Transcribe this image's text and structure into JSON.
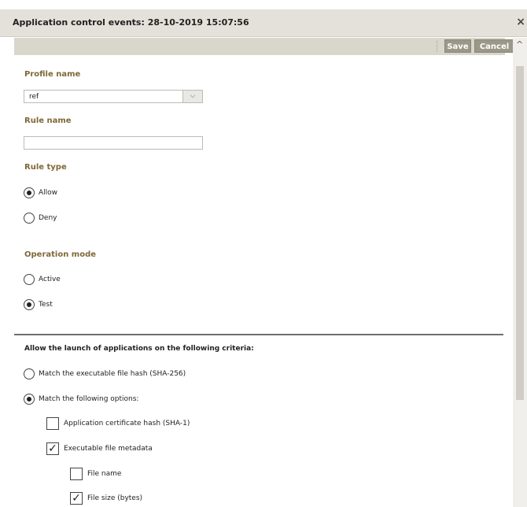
{
  "window": {
    "title": "Application control events: 28-10-2019 15:07:56",
    "close_symbol": "×"
  },
  "toolbar": {
    "save_label": "Save",
    "cancel_label": "Cancel"
  },
  "form": {
    "profile_name_label": "Profile name",
    "profile_name_value": "ref",
    "rule_name_label": "Rule name",
    "rule_name_value": "",
    "rule_type_label": "Rule type",
    "rule_type_options": [
      "Allow",
      "Deny"
    ],
    "rule_type_selected": "Allow",
    "operation_mode_label": "Operation mode",
    "operation_mode_options": [
      "Active",
      "Test"
    ],
    "operation_mode_selected": "Test"
  },
  "criteria": {
    "heading": "Allow the launch of applications on the following criteria:",
    "options": [
      "Match the executable file hash (SHA-256)",
      "Match the following options:"
    ],
    "selected": "Match the following options:",
    "checkboxes": [
      {
        "label": "Application certificate hash (SHA-1)",
        "checked": false
      },
      {
        "label": "Executable file metadata",
        "checked": true
      },
      {
        "label": "File name",
        "checked": false
      },
      {
        "label": "File size (bytes)",
        "checked": true
      }
    ]
  }
}
